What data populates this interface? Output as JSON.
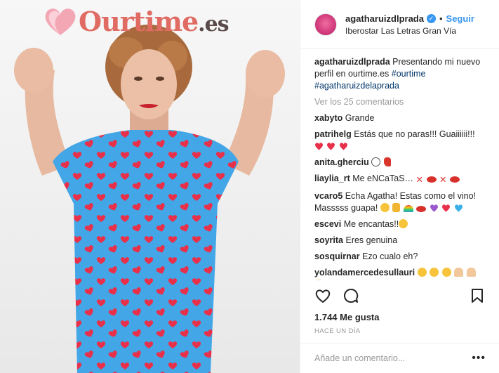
{
  "photo": {
    "logo_text": "Ourtime",
    "logo_suffix": ".es"
  },
  "header": {
    "username": "agatharuizdlprada",
    "follow_label": "Seguir",
    "dot": "•",
    "location": "Iberostar Las Letras Gran Vía"
  },
  "caption": {
    "user": "agatharuizdlprada",
    "text": "Presentando mi nuevo perfil en ourtime.es ",
    "hashtag1": "#ourtime",
    "hashtag2": "#agatharuizdelaprada"
  },
  "view_all": "Ver los 25 comentarios",
  "comments": [
    {
      "user": "xabyto",
      "text": "Grande"
    },
    {
      "user": "patrihelg",
      "text": "Estás que no paras!!! Guaiiiiii!!!"
    },
    {
      "user": "anita.gherciu",
      "text": ""
    },
    {
      "user": "liaylia_rt",
      "text": "Me eNCaTaS…"
    },
    {
      "user": "vcaro5",
      "text": "Echa Agatha! Estas como el vino! Masssss guapa!"
    },
    {
      "user": "escevi",
      "text": "Me encantas!!"
    },
    {
      "user": "soyrita",
      "text": "Eres genuina"
    },
    {
      "user": "sosquirnar",
      "text": "Ezo cualo eh?"
    },
    {
      "user": "yolandamercedesullauri",
      "text": ""
    }
  ],
  "likes": "1.744 Me gusta",
  "time": "HACE UN DÍA",
  "add_comment_placeholder": "Añade un comentario...",
  "more": "•••",
  "colors": {
    "accent_blue": "#3897f0",
    "dress_blue": "#43a6e6",
    "heart_red": "#e8304a",
    "logo_coral": "#e06b63"
  }
}
